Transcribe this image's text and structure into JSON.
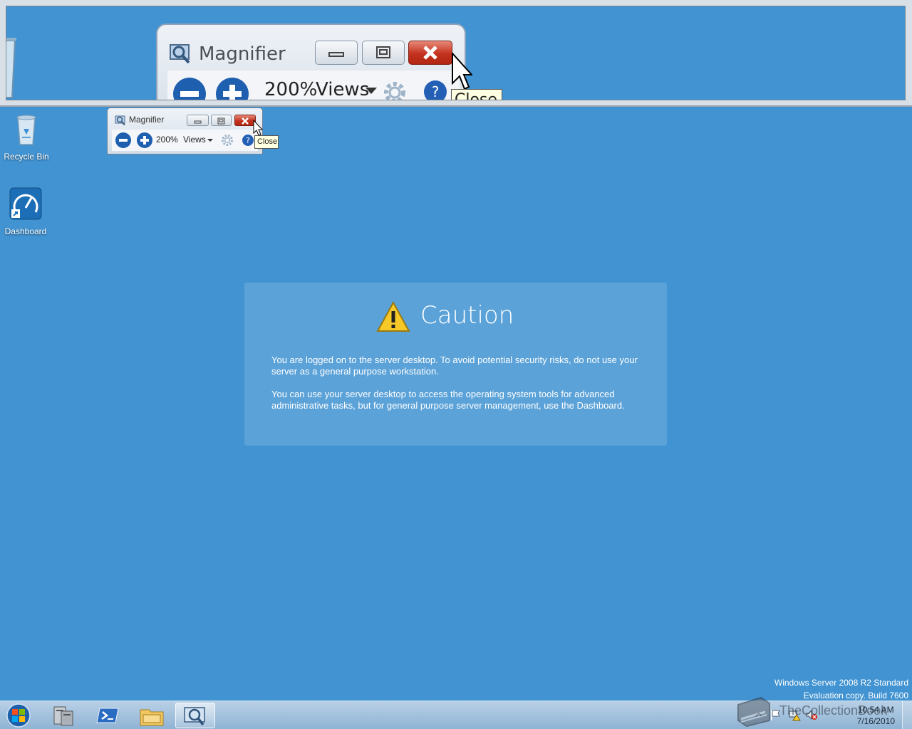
{
  "magnifier": {
    "title": "Magnifier",
    "zoom": "200%",
    "views_label": "Views",
    "tooltip": "Close"
  },
  "desktop": {
    "icons": [
      {
        "label": "Recycle Bin",
        "icon": "recycle-bin-icon"
      },
      {
        "label": "Dashboard",
        "icon": "dashboard-icon"
      }
    ]
  },
  "caution": {
    "title": "Caution",
    "paragraph1": "You are logged on to the server desktop. To avoid potential security risks, do not use your server as a general purpose workstation.",
    "paragraph2": "You can use your server desktop to access the operating system tools for advanced administrative tasks, but for general purpose server management, use the Dashboard."
  },
  "watermark": {
    "line1": "Windows Server 2008 R2 Standard",
    "line2": "Evaluation copy. Build 7600"
  },
  "overlay_watermark": "TheCollectionBook",
  "taskbar": {
    "items": [
      "start-orb-icon",
      "server-manager-icon",
      "powershell-icon",
      "explorer-icon",
      "magnifier-icon"
    ],
    "active_item": "magnifier-icon",
    "clock_time": "10:54 AM",
    "clock_date": "7/16/2010"
  },
  "colors": {
    "desktop": "#4193d2",
    "close_button": "#c3321e",
    "tooltip_bg": "#ffffe1"
  }
}
